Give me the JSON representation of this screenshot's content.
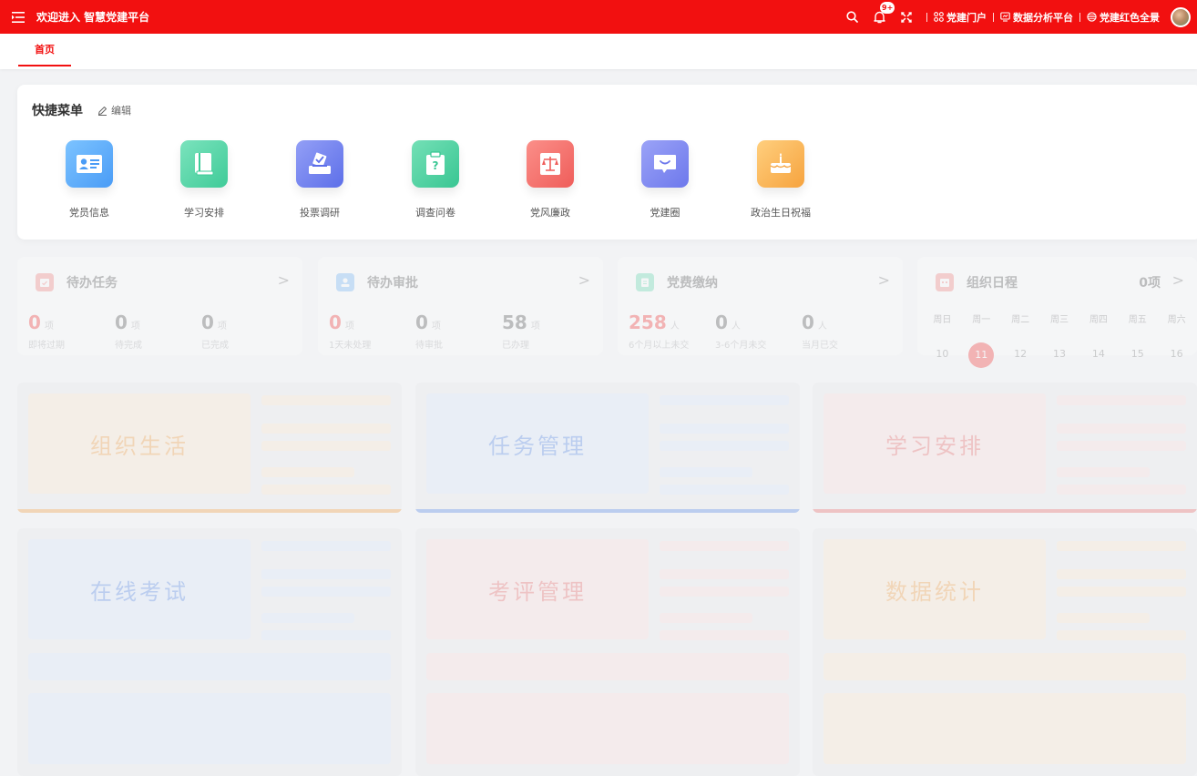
{
  "header": {
    "title": "欢迎进入 智慧党建平台",
    "bell_badge": "9+",
    "links": [
      "党建门户",
      "数据分析平台",
      "党建红色全景"
    ]
  },
  "tabs": [
    {
      "label": "首页",
      "active": true
    }
  ],
  "quick_menu": {
    "title": "快捷菜单",
    "edit_label": "编辑",
    "items": [
      {
        "label": "党员信息",
        "icon": "id-card-icon",
        "color": "#5aa9f8"
      },
      {
        "label": "学习安排",
        "icon": "book-icon",
        "color": "#49d3a2"
      },
      {
        "label": "投票调研",
        "icon": "ballot-box-icon",
        "color": "#6f80f0"
      },
      {
        "label": "调查问卷",
        "icon": "clipboard-question-icon",
        "color": "#45cf9e"
      },
      {
        "label": "党风廉政",
        "icon": "scales-icon",
        "color": "#f46f6a"
      },
      {
        "label": "党建圈",
        "icon": "chat-bubble-icon",
        "color": "#7c86f2"
      },
      {
        "label": "政治生日祝福",
        "icon": "cake-icon",
        "color": "#f9b04d"
      }
    ]
  },
  "stats": [
    {
      "title": "待办任务",
      "items": [
        {
          "value": "0",
          "unit": "项",
          "label": "即将过期",
          "highlight": true
        },
        {
          "value": "0",
          "unit": "项",
          "label": "待完成"
        },
        {
          "value": "0",
          "unit": "项",
          "label": "已完成"
        }
      ]
    },
    {
      "title": "待办审批",
      "items": [
        {
          "value": "0",
          "unit": "项",
          "label": "1天未处理",
          "highlight": true
        },
        {
          "value": "0",
          "unit": "项",
          "label": "待审批"
        },
        {
          "value": "58",
          "unit": "项",
          "label": "已办理"
        }
      ]
    },
    {
      "title": "党费缴纳",
      "items": [
        {
          "value": "258",
          "unit": "人",
          "label": "6个月以上未交",
          "highlight": true
        },
        {
          "value": "0",
          "unit": "人",
          "label": "3-6个月未交"
        },
        {
          "value": "0",
          "unit": "人",
          "label": "当月已交"
        }
      ]
    }
  ],
  "schedule": {
    "title": "组织日程",
    "count": "0项",
    "weekdays": [
      "周日",
      "周一",
      "周二",
      "周三",
      "周四",
      "周五",
      "周六"
    ],
    "days": [
      "10",
      "11",
      "12",
      "13",
      "14",
      "15",
      "16"
    ],
    "today": "11"
  },
  "features": [
    {
      "label": "组织生活",
      "text_color": "#f08a1c",
      "bg": "#fbe4c6",
      "line_color": "#fbe4c6",
      "accent": "#f08a1c"
    },
    {
      "label": "任务管理",
      "text_color": "#2f6fe0",
      "bg": "#d4e3fb",
      "line_color": "#d4e3fb",
      "accent": "#2f6fe0"
    },
    {
      "label": "学习安排",
      "text_color": "#e54a4a",
      "bg": "#fbd8d8",
      "line_color": "#fbd8d8",
      "accent": "#e54a4a"
    },
    {
      "label": "在线考试",
      "text_color": "#2f6fe0",
      "bg": "#d4e3fb",
      "line_color": "#d4e3fb"
    },
    {
      "label": "考评管理",
      "text_color": "#e54a4a",
      "bg": "#fbd8d8",
      "line_color": "#fbd8d8"
    },
    {
      "label": "数据统计",
      "text_color": "#f08a1c",
      "bg": "#fbe4c6",
      "line_color": "#fbe4c6"
    }
  ]
}
